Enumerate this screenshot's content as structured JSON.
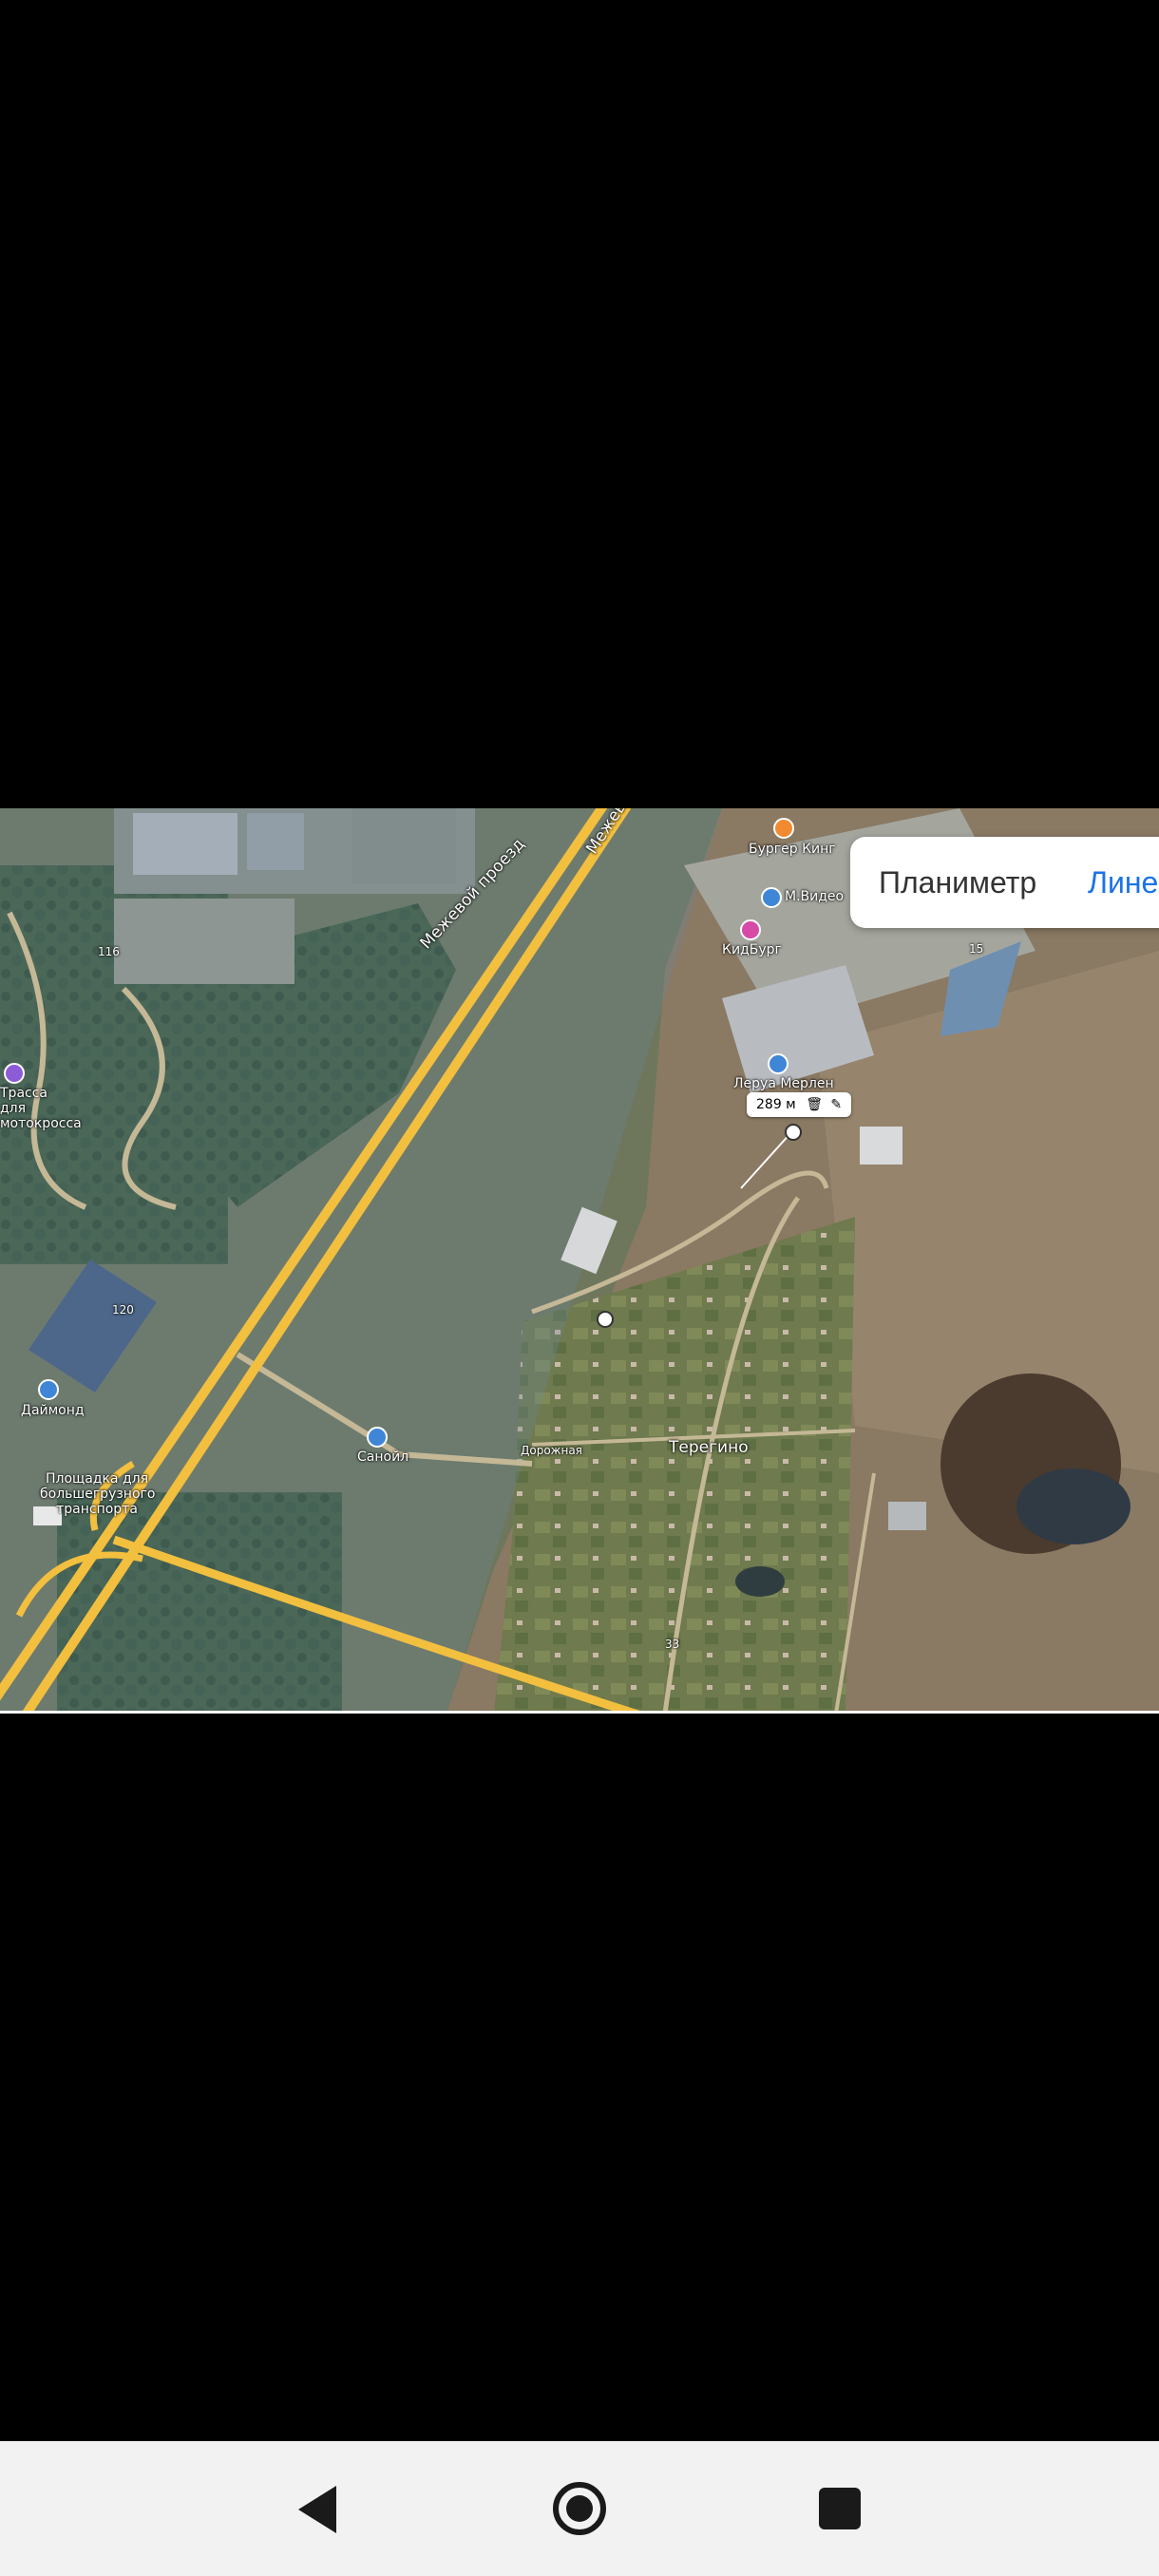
{
  "tabs": {
    "planimeter": "Планиметр",
    "ruler": "Лине"
  },
  "measure": {
    "distance": "289 м",
    "delete_icon": "trash-icon",
    "edit_icon": "pencil-icon"
  },
  "labels": {
    "road_main": "Межевой проезд",
    "road_main_top": "Межев",
    "burger_king": "Бургер Кинг",
    "m_video": "М.Видео",
    "kidburg": "КидБург",
    "leroy": "Леруа Мерлен",
    "diamond": "Даймонд",
    "sanoil": "Санойл",
    "parking": "Площадка для большегрузного транспорта",
    "cross": "Трасса для мотокросса",
    "teregino": "Терегино",
    "dorozhnaya": "Дорожная",
    "num_120": "120",
    "num_116": "116",
    "num_33": "33",
    "num_15": "15"
  },
  "colors": {
    "road": "#f2bf3f",
    "accent_blue": "#1b73e8",
    "nav_bg": "#f2f2f2"
  },
  "nav": {
    "back": "back-icon",
    "home": "home-icon",
    "recents": "recents-icon"
  }
}
